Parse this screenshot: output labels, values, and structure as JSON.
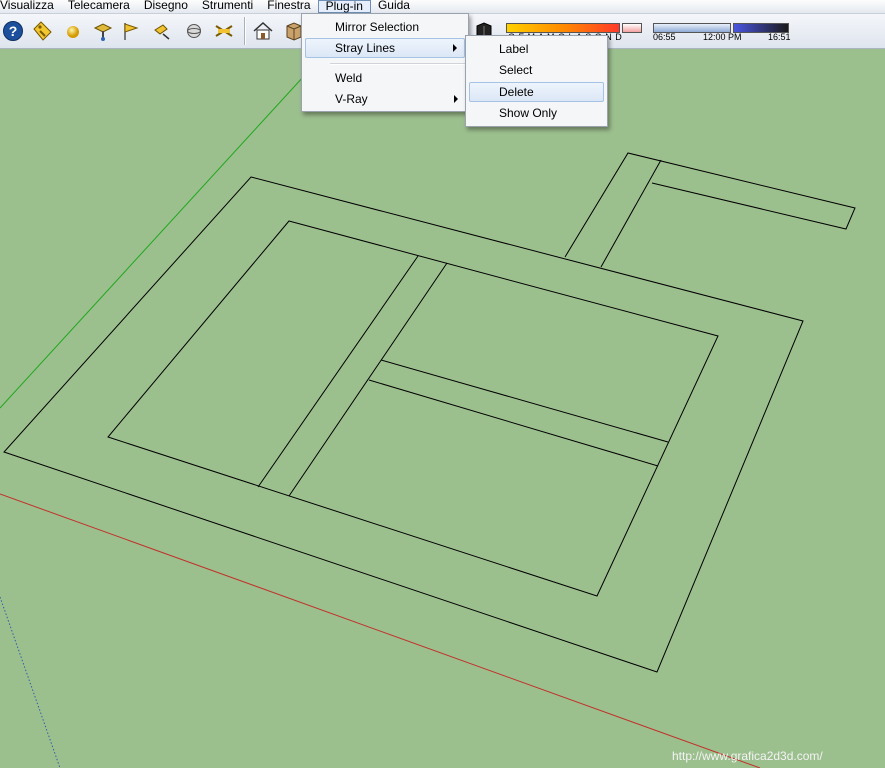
{
  "menubar": {
    "items": [
      "Visualizza",
      "Telecamera",
      "Disegno",
      "Strumenti",
      "Finestra",
      "Plug-in",
      "Guida"
    ],
    "active_index": 5
  },
  "toolbar": {
    "icons": [
      "help-icon",
      "tag-icon",
      "sphere-icon",
      "position-camera-icon",
      "walk-flag-icon",
      "look-around-icon",
      "section-plane-icon",
      "interact-icon",
      "house-view-icon",
      "box-view-icon",
      "shadow-toggle-icon"
    ]
  },
  "shadow_panel": {
    "months": "G F M A M G L A S O N D",
    "time_start": "06:55",
    "time_mid": "12:00 PM",
    "time_end": "16:51"
  },
  "plugin_menu": {
    "items": [
      {
        "label": "Mirror Selection",
        "submenu": false
      },
      {
        "label": "Stray Lines",
        "submenu": true,
        "highlighted": true
      },
      {
        "label": "Weld",
        "submenu": false
      },
      {
        "label": "V-Ray",
        "submenu": true
      }
    ]
  },
  "stray_lines_menu": {
    "items": [
      {
        "label": "Label"
      },
      {
        "label": "Select"
      },
      {
        "label": "Delete",
        "highlighted": true
      },
      {
        "label": "Show Only"
      }
    ]
  },
  "colors": {
    "viewport_bg": "#9cbf8e",
    "green_axis": "#1fa81f",
    "red_axis": "#c0322a",
    "blue_axis": "#2f5fa8",
    "edge": "#000000"
  },
  "watermark": "http://www.grafica2d3d.com/"
}
